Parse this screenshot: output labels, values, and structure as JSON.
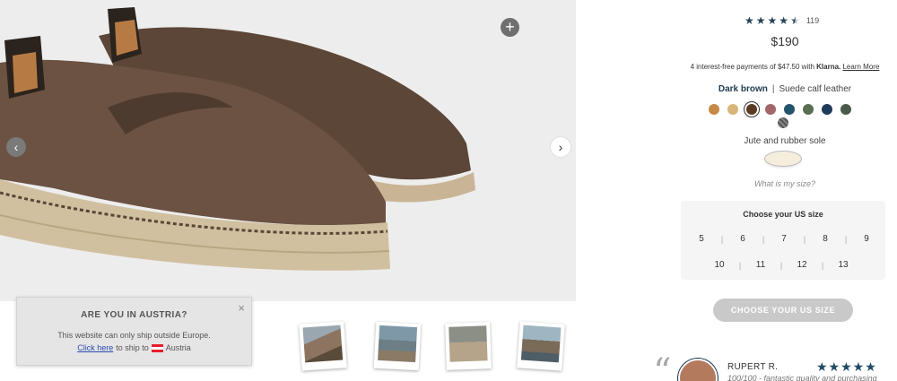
{
  "product": {
    "rating_count": "119",
    "rating_value": 4.5,
    "price": "$190"
  },
  "klarna": {
    "text": "4 interest-free payments of $47.50 with",
    "brand": "Klarna.",
    "learn_more": "Learn More"
  },
  "color": {
    "name": "Dark brown",
    "material": "Suede calf leather",
    "swatches": [
      "#c58a45",
      "#d8b57a",
      "#5a3b22",
      "#a1656a",
      "#24536c",
      "#5a6e52",
      "#1f3b5a",
      "#4a5a4a"
    ]
  },
  "sole": {
    "label": "Jute and rubber sole"
  },
  "size_help": "What is my size?",
  "sizes": {
    "title": "Choose your US size",
    "row1": [
      "5",
      "6",
      "7",
      "8",
      "9"
    ],
    "row2": [
      "10",
      "11",
      "12",
      "13"
    ]
  },
  "cta": {
    "label": "CHOOSE YOUR US SIZE"
  },
  "popup": {
    "title": "ARE YOU IN AUSTRIA?",
    "text": "This website can only ship outside Europe.",
    "link": "Click here",
    "link_suffix": "to ship to",
    "country": "Austria",
    "close": "×"
  },
  "gallery": {
    "zoom": "+",
    "prev": "‹",
    "next": "›"
  },
  "review": {
    "quote": "“",
    "name": "RUPERT R.",
    "stars": "★★★★★",
    "text": "100/100 - fantastic quality and purchasing"
  }
}
